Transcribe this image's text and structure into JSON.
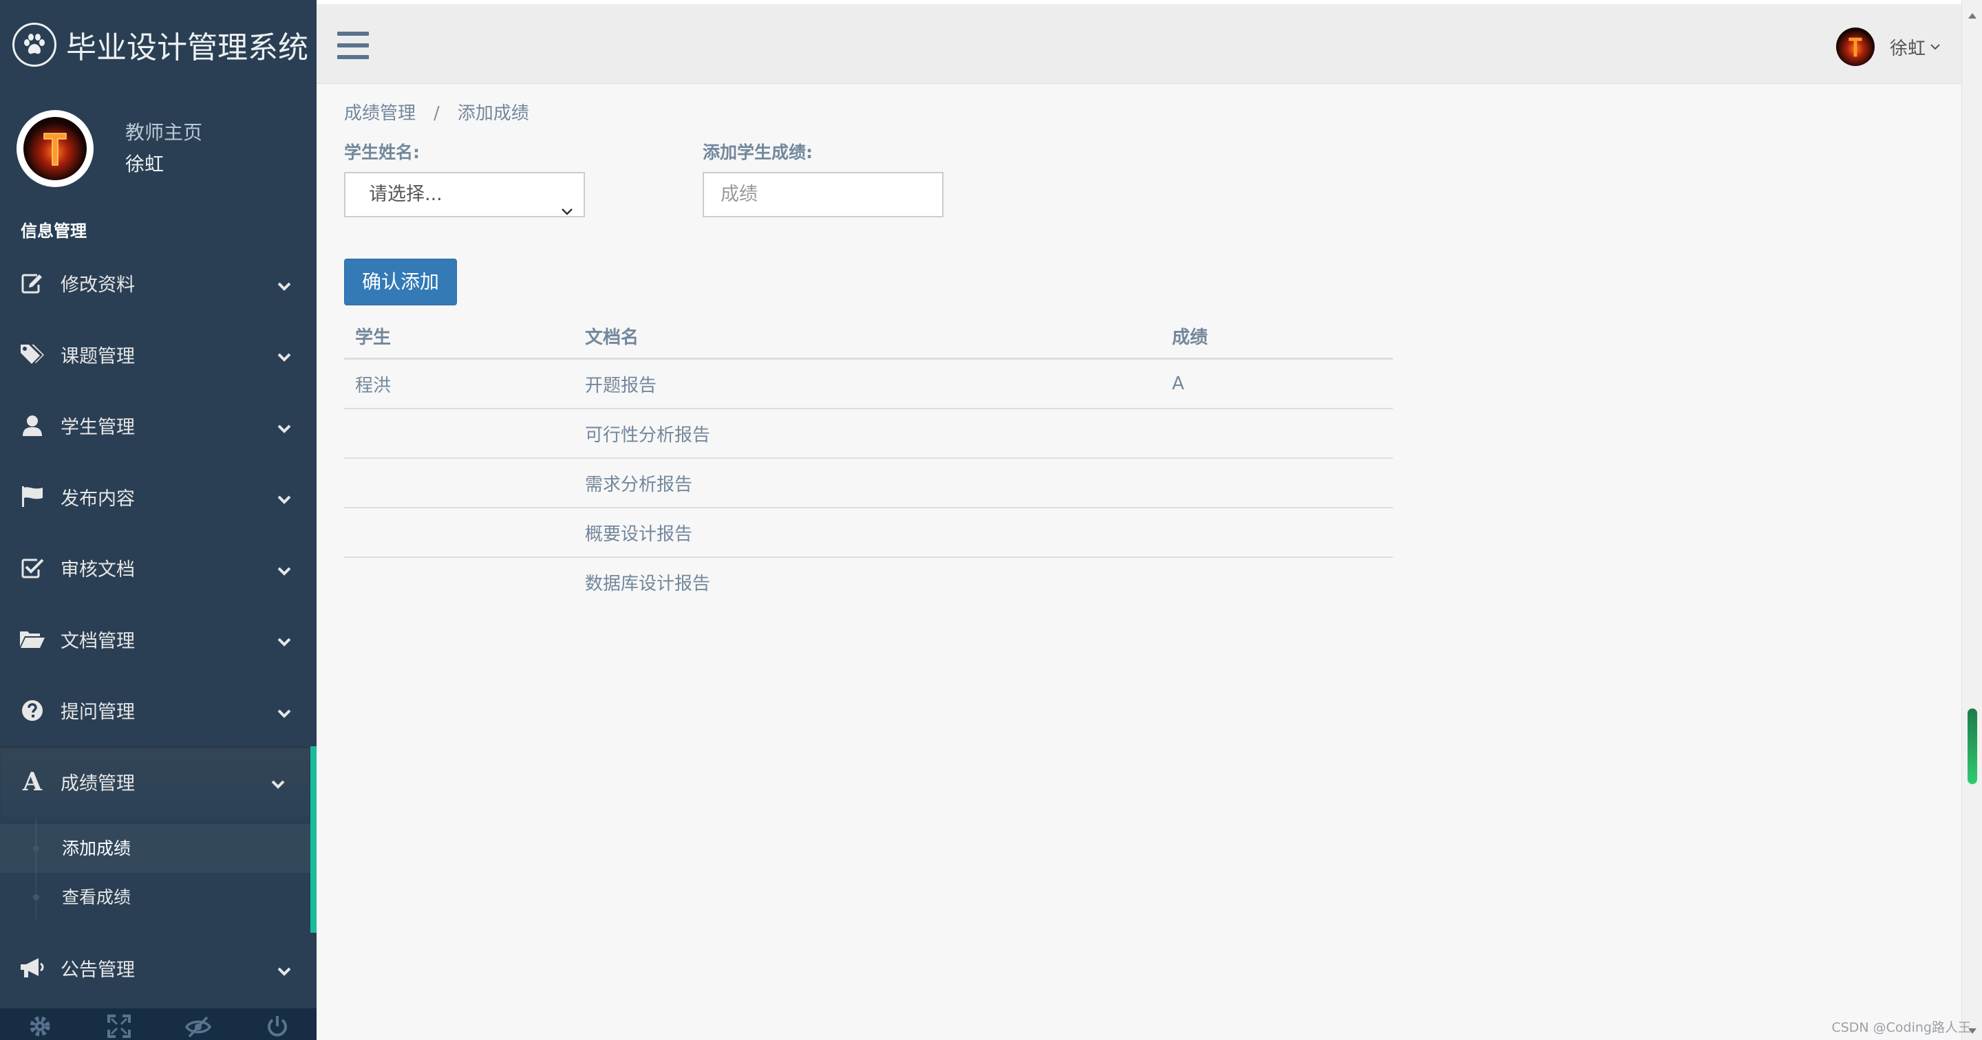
{
  "app": {
    "title": "毕业设计管理系统"
  },
  "profile": {
    "welcome": "教师主页",
    "name": "徐虹"
  },
  "sidebar": {
    "section_title": "信息管理",
    "items": [
      {
        "label": "修改资料",
        "icon": "edit-icon"
      },
      {
        "label": "课题管理",
        "icon": "tags-icon"
      },
      {
        "label": "学生管理",
        "icon": "user-icon"
      },
      {
        "label": "发布内容",
        "icon": "flag-icon"
      },
      {
        "label": "审核文档",
        "icon": "check-square-icon"
      },
      {
        "label": "文档管理",
        "icon": "folder-open-icon"
      },
      {
        "label": "提问管理",
        "icon": "question-circle-icon"
      },
      {
        "label": "成绩管理",
        "icon": "font-icon",
        "active": true
      },
      {
        "label": "公告管理",
        "icon": "bullhorn-icon"
      }
    ],
    "submenu": [
      {
        "label": "添加成绩",
        "current": true
      },
      {
        "label": "查看成绩",
        "current": false
      }
    ],
    "footer_icons": [
      "settings-icon",
      "fullscreen-icon",
      "lock-icon",
      "logout-icon"
    ]
  },
  "topnav": {
    "user_name": "徐虹"
  },
  "breadcrumb": {
    "parent": "成绩管理",
    "separator": "/",
    "current": "添加成绩"
  },
  "form": {
    "student_label": "学生姓名:",
    "student_select_value": "请选择...",
    "grade_label": "添加学生成绩:",
    "grade_placeholder": "成绩",
    "submit_label": "确认添加"
  },
  "table": {
    "headers": [
      "学生",
      "文档名",
      "成绩"
    ],
    "rows": [
      [
        "程洪",
        "开题报告",
        "A"
      ],
      [
        "",
        "可行性分析报告",
        ""
      ],
      [
        "",
        "需求分析报告",
        ""
      ],
      [
        "",
        "概要设计报告",
        ""
      ],
      [
        "",
        "数据库设计报告",
        ""
      ]
    ]
  },
  "watermark": "CSDN @Coding路人王",
  "colors": {
    "sidebar_bg": "#2a3f54",
    "sidebar_footer_bg": "#172d44",
    "active_accent": "#1abb9c",
    "primary_button": "#337ab7",
    "content_bg": "#f7f7f7",
    "text": "#73879c"
  }
}
